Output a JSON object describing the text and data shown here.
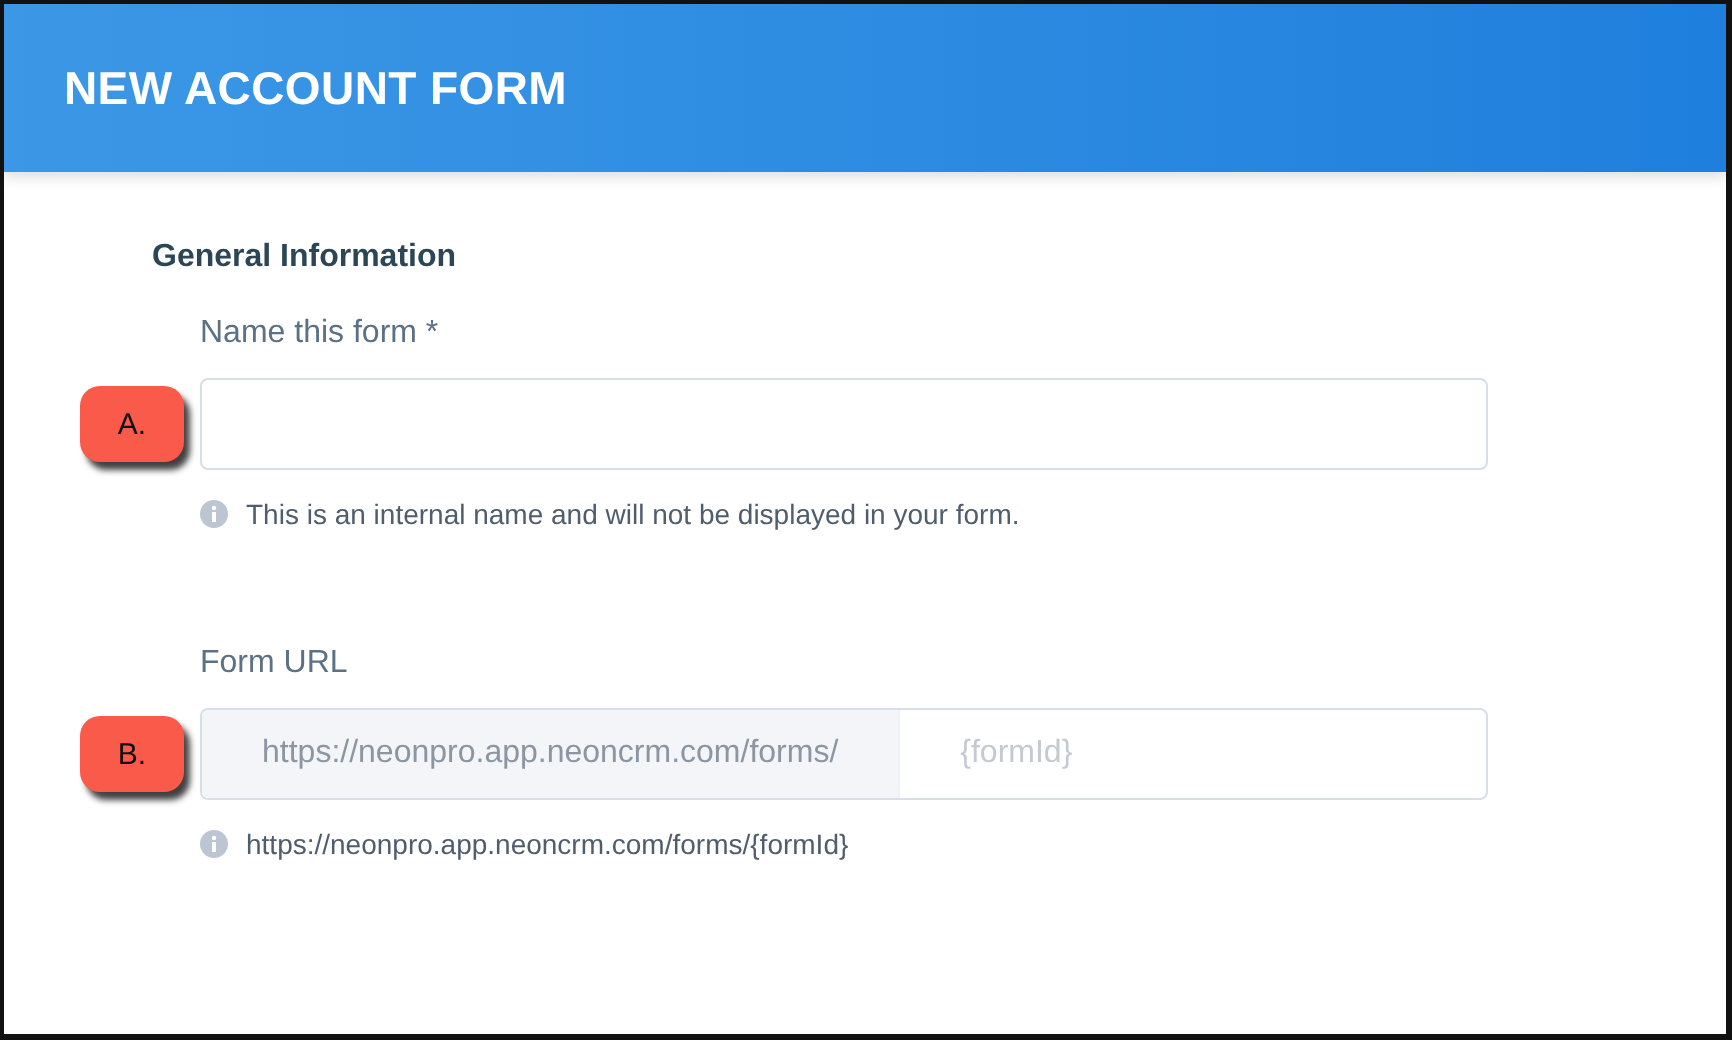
{
  "header": {
    "title": "NEW ACCOUNT FORM"
  },
  "section": {
    "title": "General Information"
  },
  "fields": [
    {
      "kind": "text",
      "label": "Name this form *",
      "marker": "A.",
      "help": "This is an internal name and will not be displayed in your form."
    },
    {
      "kind": "url",
      "label": "Form URL",
      "marker": "B.",
      "prefix": "https://neonpro.app.neoncrm.com/forms/",
      "placeholder": "{formId}",
      "help": "https://neonpro.app.neoncrm.com/forms/{formId}"
    }
  ]
}
